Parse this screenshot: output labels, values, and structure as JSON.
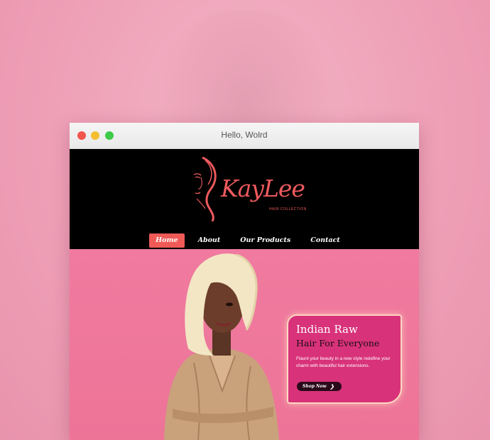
{
  "window": {
    "title": "Hello, Wolrd"
  },
  "brand": {
    "name": "KayLee",
    "tagline": "HAIR COLLECTION",
    "accent": "#ee5a5d"
  },
  "nav": {
    "items": [
      {
        "label": "Home",
        "active": true
      },
      {
        "label": "About",
        "active": false
      },
      {
        "label": "Our Products",
        "active": false
      },
      {
        "label": "Contact",
        "active": false
      }
    ]
  },
  "hero": {
    "title_line1": "Indian Raw",
    "title_line2": "Hair For Everyone",
    "description": "Flaunt your beauty in a new style redefine your charm with beautiful hair extensions.",
    "cta_label": "Shop Now",
    "cta_icon": "chevron-right-icon",
    "background": "#f07aa0",
    "card_color": "#d8327a"
  }
}
